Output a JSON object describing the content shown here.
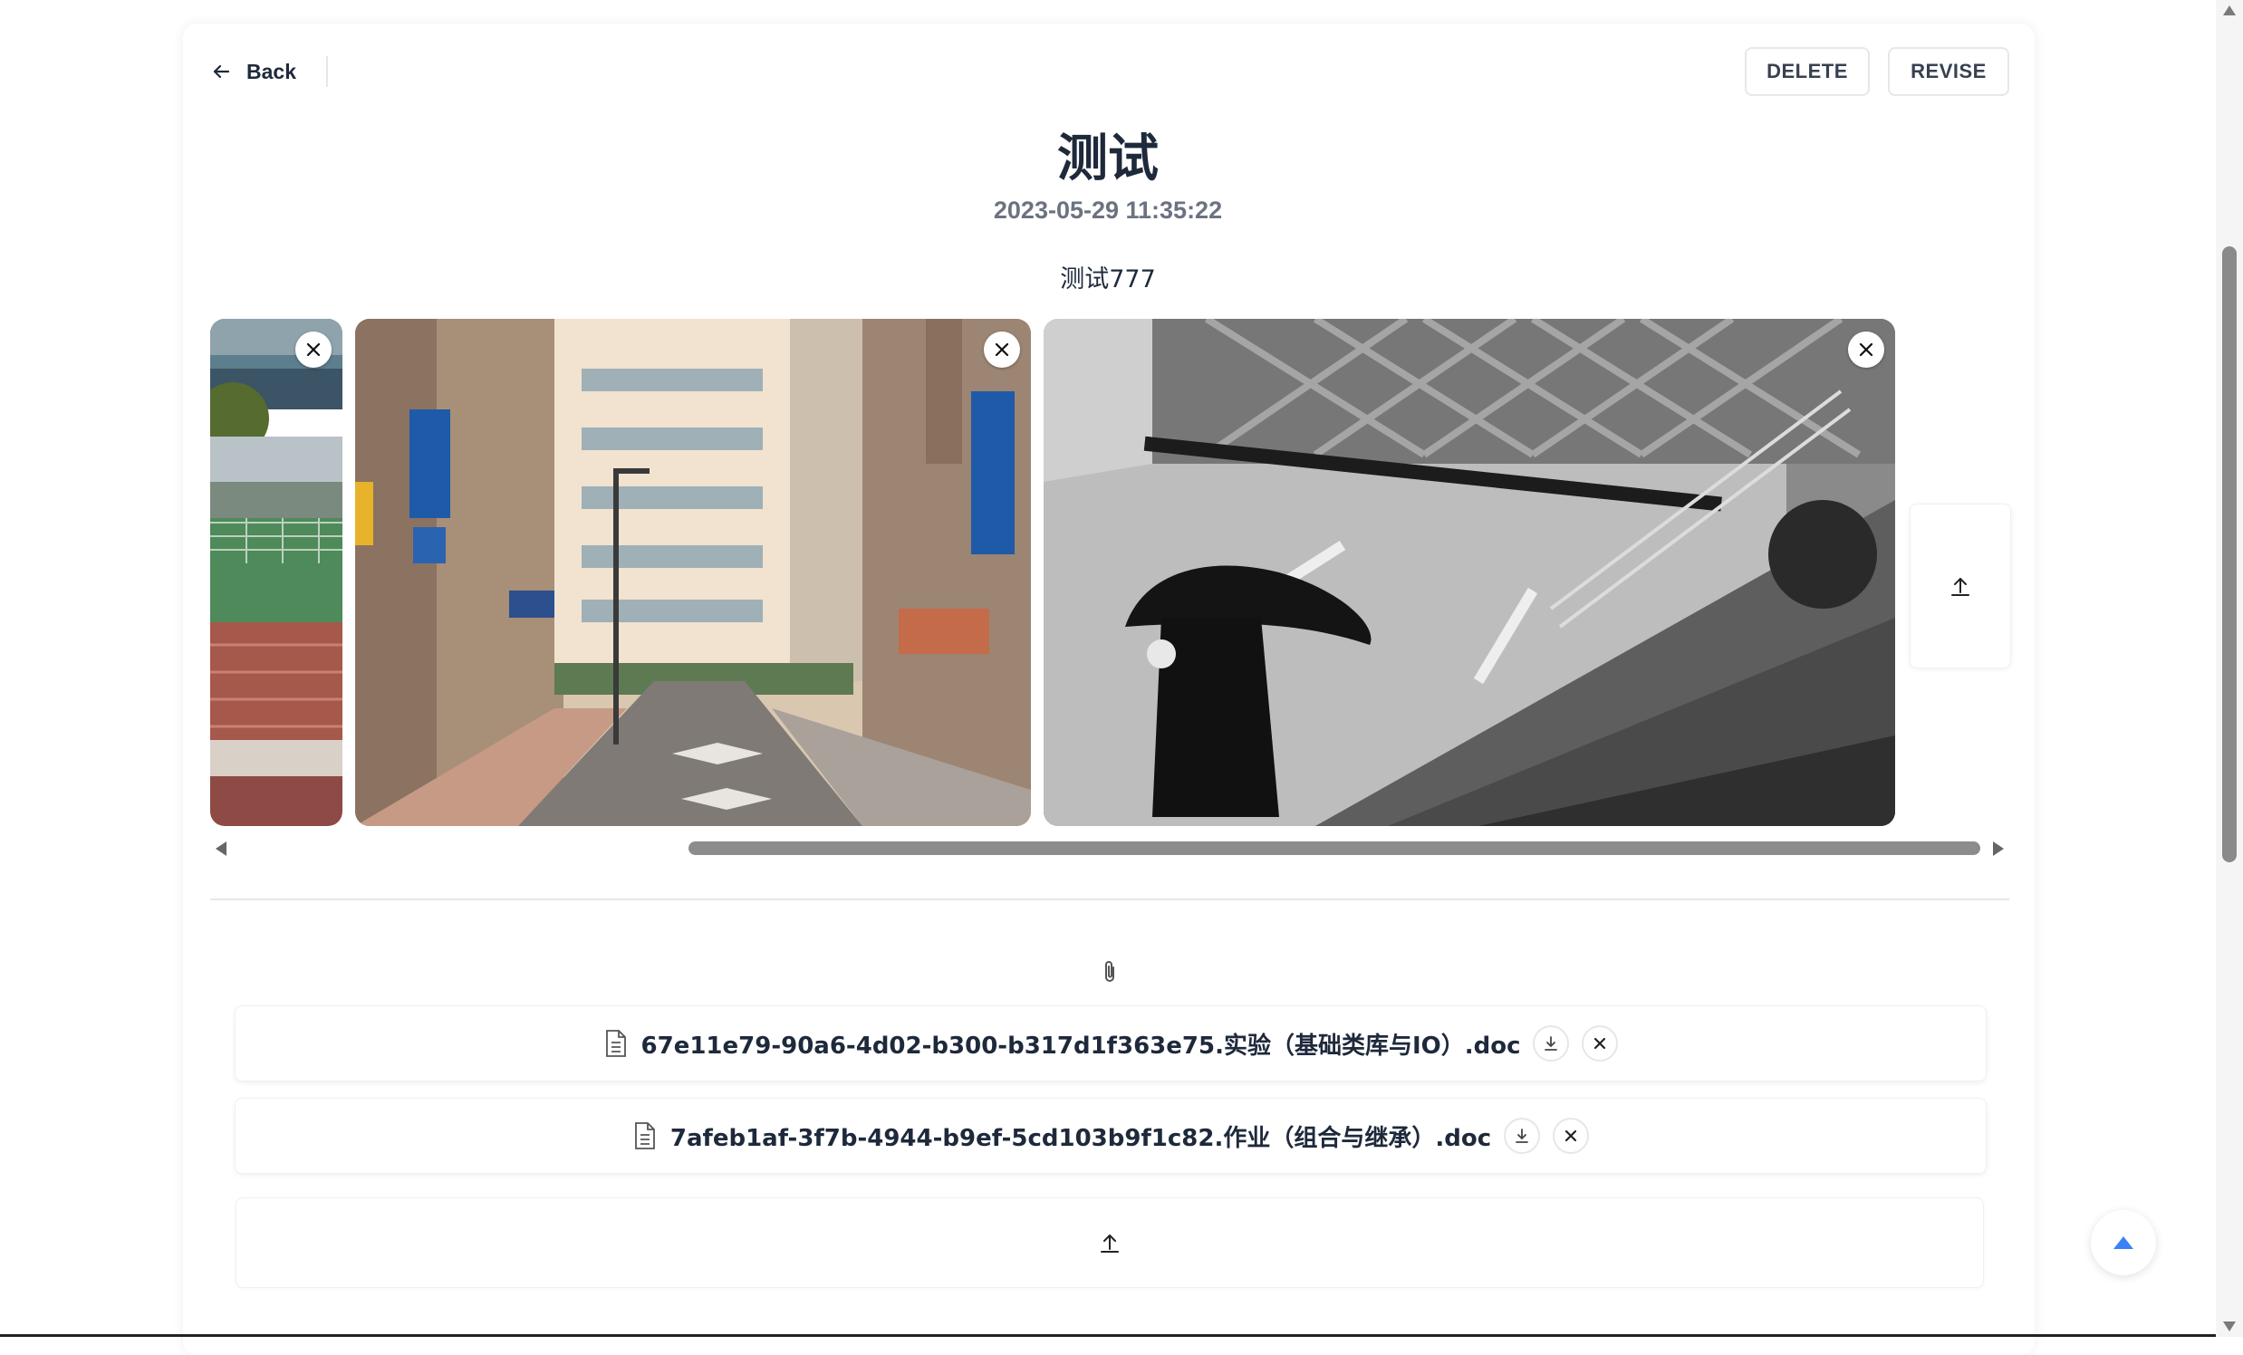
{
  "header": {
    "back_label": "Back",
    "delete_label": "DELETE",
    "revise_label": "REVISE"
  },
  "post": {
    "title": "测试",
    "datetime": "2023-05-29 11:35:22",
    "content": "测试777"
  },
  "gallery": {
    "images": [
      {
        "name": "stadium-photo",
        "remove_icon": "close-icon"
      },
      {
        "name": "street-photo",
        "remove_icon": "close-icon"
      },
      {
        "name": "umbrella-photo",
        "remove_icon": "close-icon"
      }
    ],
    "upload_icon": "upload-icon",
    "scroll_position_fraction": 0.28
  },
  "attachments": {
    "files": [
      {
        "name": "67e11e79-90a6-4d02-b300-b317d1f363e75.实验（基础类库与IO）.doc",
        "download_icon": "download-icon",
        "remove_icon": "close-icon"
      },
      {
        "name": "7afeb1af-3f7b-4944-b9ef-5cd103b9f1c82.作业（组合与继承）.doc",
        "download_icon": "download-icon",
        "remove_icon": "close-icon"
      }
    ],
    "upload_icon": "upload-icon"
  },
  "colors": {
    "accent": "#3b82f6",
    "text": "#1e293b",
    "muted": "#6b7280"
  }
}
